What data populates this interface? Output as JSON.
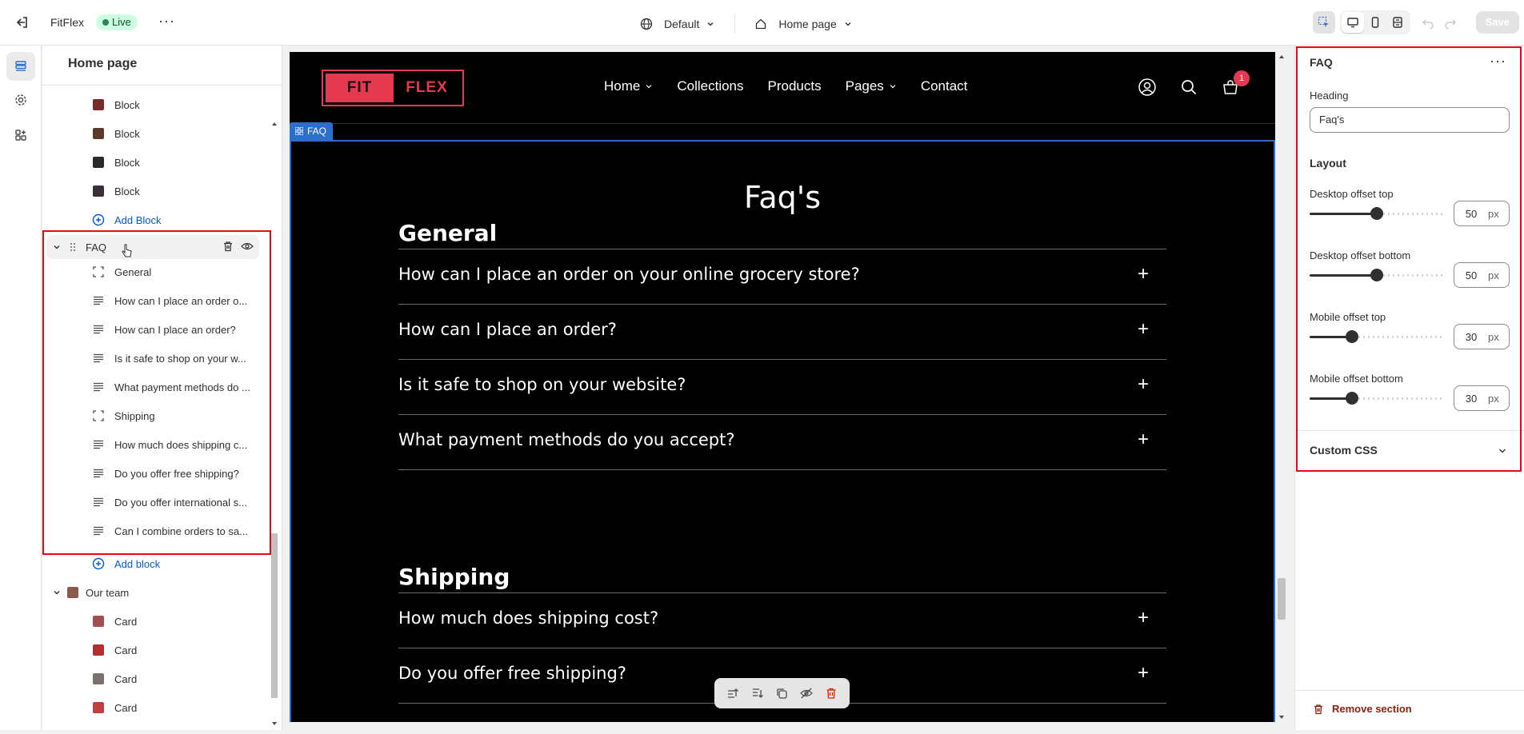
{
  "topbar": {
    "store_name": "FitFlex",
    "status_badge": "Live",
    "theme_selector": "Default",
    "page_selector": "Home page",
    "save_label": "Save"
  },
  "left_panel": {
    "title": "Home page",
    "items": [
      {
        "label": "Block",
        "type": "image-block"
      },
      {
        "label": "Block",
        "type": "image-block"
      },
      {
        "label": "Block",
        "type": "image-block"
      },
      {
        "label": "Block",
        "type": "image-block"
      },
      {
        "label": "Add Block",
        "type": "add"
      }
    ],
    "faq_section": {
      "label": "FAQ",
      "children": [
        {
          "label": "General",
          "type": "group"
        },
        {
          "label": "How can I place an order o...",
          "type": "text"
        },
        {
          "label": "How can I place an order?",
          "type": "text"
        },
        {
          "label": "Is it safe to shop on your w...",
          "type": "text"
        },
        {
          "label": "What payment methods do ...",
          "type": "text"
        },
        {
          "label": "Shipping",
          "type": "group"
        },
        {
          "label": "How much does shipping c...",
          "type": "text"
        },
        {
          "label": "Do you offer free shipping?",
          "type": "text"
        },
        {
          "label": "Do you offer international s...",
          "type": "text"
        },
        {
          "label": "Can I combine orders to sa...",
          "type": "text"
        }
      ],
      "add_label": "Add block"
    },
    "team_section": {
      "label": "Our team",
      "children": [
        "Card",
        "Card",
        "Card",
        "Card"
      ]
    }
  },
  "preview": {
    "logo_left": "FIT",
    "logo_right": "FLEX",
    "nav": [
      "Home",
      "Collections",
      "Products",
      "Pages",
      "Contact"
    ],
    "cart_count": "1",
    "section_tag": "FAQ",
    "heading": "Faq's",
    "categories": [
      {
        "title": "General",
        "questions": [
          "How can I place an order on your online grocery store?",
          "How can I place an order?",
          "Is it safe to shop on your website?",
          "What payment methods do you accept?"
        ]
      },
      {
        "title": "Shipping",
        "questions": [
          "How much does shipping cost?",
          "Do you offer free shipping?"
        ]
      }
    ]
  },
  "right_panel": {
    "title": "FAQ",
    "heading_label": "Heading",
    "heading_value": "Faq's",
    "layout_label": "Layout",
    "sliders": [
      {
        "label": "Desktop offset top",
        "value": "50",
        "unit": "px",
        "fraction": 0.5
      },
      {
        "label": "Desktop offset bottom",
        "value": "50",
        "unit": "px",
        "fraction": 0.5
      },
      {
        "label": "Mobile offset top",
        "value": "30",
        "unit": "px",
        "fraction": 0.3
      },
      {
        "label": "Mobile offset bottom",
        "value": "30",
        "unit": "px",
        "fraction": 0.3
      }
    ],
    "custom_css_label": "Custom CSS",
    "remove_label": "Remove section"
  },
  "colors": {
    "accent": "#e53950",
    "highlight_outline": "#e50914",
    "selection_blue": "#2c6ecb",
    "link_blue": "#005bd3"
  }
}
